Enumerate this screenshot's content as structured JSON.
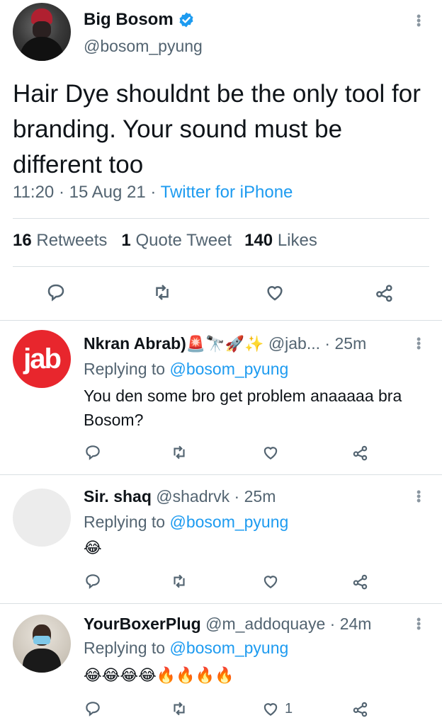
{
  "main_tweet": {
    "display_name": "Big Bosom",
    "handle": "@bosom_pyung",
    "text": "Hair Dye shouldnt be the only tool for branding. Your sound must be different too",
    "time": "11:20",
    "date": "15 Aug 21",
    "source": "Twitter for iPhone",
    "dot": "·",
    "retweets_count": "16",
    "retweets_label": "Retweets",
    "quotes_count": "1",
    "quotes_label": "Quote Tweet",
    "likes_count": "140",
    "likes_label": "Likes"
  },
  "replies": [
    {
      "display_name": "Nkran Abrab)",
      "name_emojis": "🚨🔭🚀✨",
      "handle": "@jab...",
      "time": "25m",
      "replying_prefix": "Replying to",
      "replying_to": "@bosom_pyung",
      "text": "You den some bro get problem anaaaaa bra Bosom?",
      "like_count": "",
      "avatar_text": "jab"
    },
    {
      "display_name": "Sir. shaq",
      "handle": "@shadrvk",
      "time": "25m",
      "replying_prefix": "Replying to",
      "replying_to": "@bosom_pyung",
      "text": "😂",
      "like_count": ""
    },
    {
      "display_name": "YourBoxerPlug",
      "handle": "@m_addoquaye",
      "time": "24m",
      "replying_prefix": "Replying to",
      "replying_to": "@bosom_pyung",
      "text": "😂😂😂😂🔥🔥🔥🔥",
      "like_count": "1"
    }
  ],
  "colors": {
    "accent": "#1d9bf0",
    "secondary_text": "#536471",
    "primary_text": "#0f1419",
    "divider": "#d9dfe3"
  },
  "icons": [
    "verified-badge-icon",
    "more-icon",
    "reply-icon",
    "retweet-icon",
    "like-icon",
    "share-icon"
  ]
}
